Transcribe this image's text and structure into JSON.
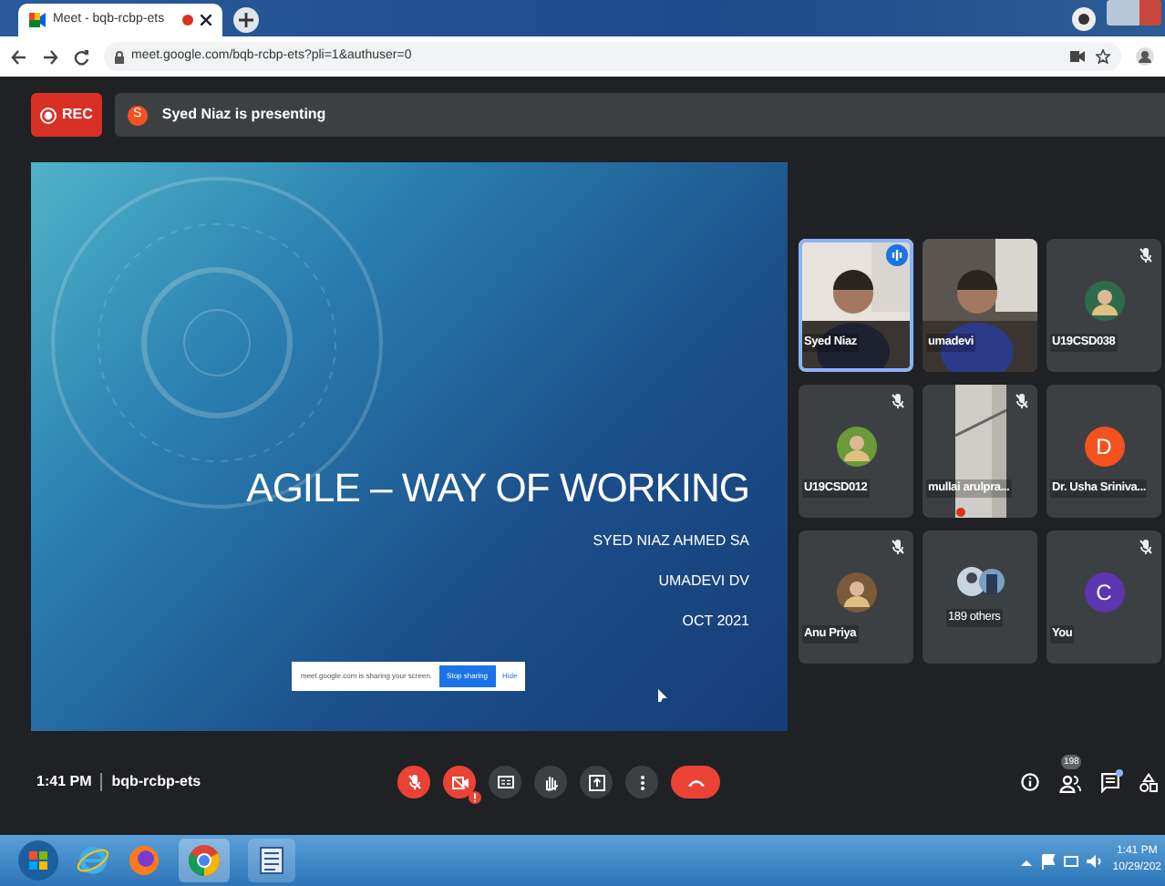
{
  "browser": {
    "tab_title": "Meet - bqb-rcbp-ets",
    "recording_dot": true,
    "address": "meet.google.com/bqb-rcbp-ets?pli=1&authuser=0"
  },
  "meet": {
    "rec_label": "REC",
    "presenter_initial": "S",
    "presenter_banner": "Syed Niaz is presenting"
  },
  "slide": {
    "title": "AGILE – WAY OF WORKING",
    "lines": [
      "SYED NIAZ AHMED SA",
      "UMADEVI DV",
      "OCT 2021"
    ]
  },
  "share_notice": {
    "text": "meet.google.com is sharing your screen.",
    "stop_button": "Stop sharing",
    "hide_link": "Hide"
  },
  "tiles": [
    {
      "name": "Syed Niaz",
      "kind": "video",
      "muted": false,
      "speaking": true,
      "selected": true
    },
    {
      "name": "umadevi",
      "kind": "video",
      "muted": false,
      "speaking": false,
      "selected": false
    },
    {
      "name": "U19CSD038",
      "kind": "avatar",
      "muted": true,
      "speaking": false,
      "selected": false,
      "color": "#2f6b4a"
    },
    {
      "name": "U19CSD012",
      "kind": "avatar",
      "muted": true,
      "speaking": false,
      "selected": false,
      "color": "#6a9a3a"
    },
    {
      "name": "mullai arulpra...",
      "kind": "wall",
      "muted": true,
      "speaking": false,
      "selected": false
    },
    {
      "name": "Dr. Usha Sriniva...",
      "kind": "letter",
      "letter": "D",
      "muted": false,
      "speaking": false,
      "selected": false,
      "color": "#f4511e"
    },
    {
      "name": "Anu Priya",
      "kind": "avatar",
      "muted": true,
      "speaking": false,
      "selected": false,
      "color": "#7a5a3a"
    },
    {
      "name": "189 others",
      "kind": "others",
      "muted": false,
      "speaking": false,
      "selected": false
    },
    {
      "name": "You",
      "kind": "letter",
      "letter": "C",
      "muted": true,
      "speaking": false,
      "selected": false,
      "color": "#5e35b1"
    }
  ],
  "bottom_bar": {
    "time": "1:41 PM",
    "meeting_code": "bqb-rcbp-ets",
    "mic_off": true,
    "camera_off": true,
    "participant_count": "198",
    "chat_unread": true
  },
  "taskbar": {
    "time": "1:41 PM",
    "date": "10/29/202"
  }
}
